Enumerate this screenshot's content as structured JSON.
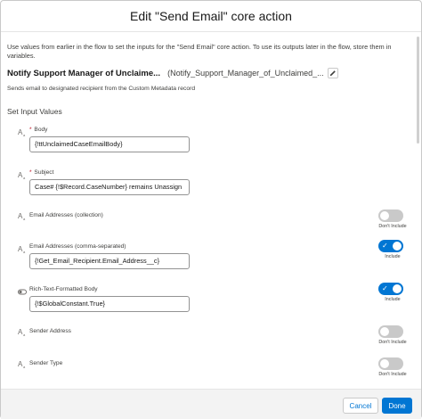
{
  "header": {
    "title": "Edit \"Send Email\" core action"
  },
  "intro_text": "Use values from earlier in the flow to set the inputs for the \"Send Email\" core action. To use its outputs later in the flow, store them in variables.",
  "action": {
    "label": "Notify Support Manager of Unclaime...",
    "api_name": "(Notify_Support_Manager_of_Unclaimed_...",
    "description": "Sends email to designated recipient from the Custom Metadata record"
  },
  "section_title": "Set Input Values",
  "params": [
    {
      "label": "Body",
      "required": "*",
      "value": "{!ttUnclaimedCaseEmailBody}",
      "icon": "text-type-icon"
    },
    {
      "label": "Subject",
      "required": "*",
      "value": "Case# {!$Record.CaseNumber} remains Unassign",
      "icon": "text-type-icon"
    },
    {
      "label": "Email Addresses (collection)",
      "toggle": "off",
      "toggle_caption": "Don't Include",
      "icon": "text-type-icon"
    },
    {
      "label": "Email Addresses (comma-separated)",
      "value": "{!Get_Email_Recipient.Email_Address__c}",
      "toggle": "on",
      "toggle_caption": "Include",
      "icon": "text-type-icon"
    },
    {
      "label": "Rich-Text-Formatted Body",
      "value": "{!$GlobalConstant.True}",
      "toggle": "on",
      "toggle_caption": "Include",
      "icon": "toggle-type-icon"
    },
    {
      "label": "Sender Address",
      "toggle": "off",
      "toggle_caption": "Don't Include",
      "icon": "text-type-icon"
    },
    {
      "label": "Sender Type",
      "toggle": "off",
      "toggle_caption": "Don't Include",
      "icon": "text-type-icon"
    }
  ],
  "footer": {
    "cancel_label": "Cancel",
    "done_label": "Done"
  },
  "colors": {
    "brand": "#0176d3",
    "required": "#ba0517",
    "toggle_off": "#c9c9c9"
  }
}
